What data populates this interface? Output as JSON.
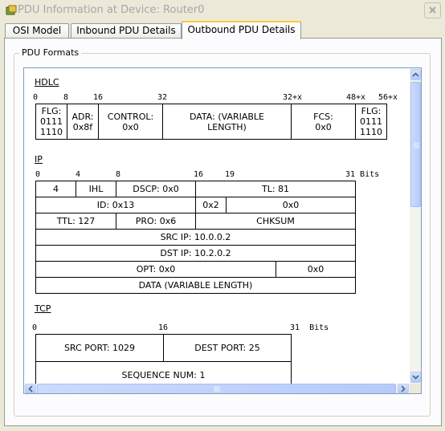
{
  "window": {
    "title": "PDU Information at Device: Router0"
  },
  "tabs": [
    {
      "label": "OSI Model"
    },
    {
      "label": "Inbound PDU Details"
    },
    {
      "label": "Outbound PDU Details",
      "active": true
    }
  ],
  "group": {
    "label": "PDU Formats"
  },
  "hdlc": {
    "title": "HDLC",
    "ticks": [
      "0",
      "8",
      "16",
      "32",
      "32+x",
      "48+x",
      "56+x"
    ],
    "fields": [
      {
        "text": "FLG: 0111 1110"
      },
      {
        "text": "ADR: 0x8f"
      },
      {
        "text": "CONTROL: 0x0"
      },
      {
        "text": "DATA: (VARIABLE LENGTH)"
      },
      {
        "text": "FCS: 0x0"
      },
      {
        "text": "FLG: 0111 1110"
      }
    ]
  },
  "ip": {
    "title": "IP",
    "ticks": [
      "0",
      "4",
      "8",
      "16",
      "19",
      "31 Bits"
    ],
    "row1": [
      "4",
      "IHL",
      "DSCP: 0x0",
      "TL: 81"
    ],
    "row2": [
      "ID: 0x13",
      "0x2",
      "0x0"
    ],
    "row3": [
      "TTL: 127",
      "PRO: 0x6",
      "CHKSUM"
    ],
    "row4": "SRC IP: 10.0.0.2",
    "row5": "DST IP: 10.2.0.2",
    "row6": [
      "OPT: 0x0",
      "0x0"
    ],
    "row7": "DATA (VARIABLE LENGTH)"
  },
  "tcp": {
    "title": "TCP",
    "ticks": [
      "0",
      "16",
      "31  Bits"
    ],
    "row1": [
      "SRC PORT: 1029",
      "DEST PORT: 25"
    ],
    "row2": "SEQUENCE NUM: 1"
  },
  "icons": {
    "app": "packet-tracer-icon",
    "close": "close-icon",
    "scroll_up": "arrow-up-icon",
    "scroll_down": "arrow-down-icon",
    "scroll_left": "arrow-left-icon",
    "scroll_right": "arrow-right-icon"
  }
}
